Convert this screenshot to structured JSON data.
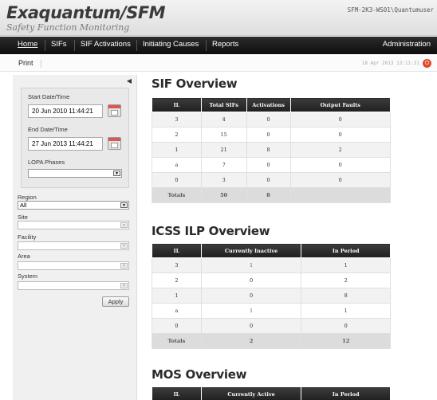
{
  "header": {
    "app_title": "Exaquantum/SFM",
    "app_subtitle": "Safety Function Monitoring",
    "server_user": "SFM-2K3-WS01\\Quantumuser"
  },
  "nav": {
    "items": [
      "Home",
      "SIFs",
      "SIF Activations",
      "Initiating Causes",
      "Reports"
    ],
    "admin": "Administration"
  },
  "toolbar": {
    "print": "Print",
    "timestamp": "18 Apr 2013 13:11:31",
    "status_icon": "power-icon"
  },
  "sidebar": {
    "start_label": "Start Date/Time",
    "start_value": "20 Jun 2010 11:44:21",
    "end_label": "End Date/Time",
    "end_value": "27 Jun 2013 11:44:21",
    "lopa_label": "LOPA Phases",
    "lopa_value": "",
    "region_label": "Region",
    "region_value": "All",
    "site_label": "Site",
    "facility_label": "Facility",
    "area_label": "Area",
    "system_label": "System",
    "apply": "Apply"
  },
  "sif_overview": {
    "title": "SIF Overview",
    "columns": [
      "IL",
      "Total SIFs",
      "Activations",
      "Output Faults"
    ],
    "rows": [
      [
        "3",
        "4",
        "0",
        "0"
      ],
      [
        "2",
        "15",
        "0",
        "0"
      ],
      [
        "1",
        "21",
        "8",
        "2"
      ],
      [
        "a",
        "7",
        "0",
        "0"
      ],
      [
        "0",
        "3",
        "0",
        "0"
      ]
    ],
    "totals": [
      "Totals",
      "50",
      "8",
      ""
    ]
  },
  "icss_overview": {
    "title": "ICSS ILP Overview",
    "columns": [
      "IL",
      "Currently Inactive",
      "In Period"
    ],
    "rows": [
      [
        "3",
        "1",
        "1"
      ],
      [
        "2",
        "0",
        "2"
      ],
      [
        "1",
        "0",
        "8"
      ],
      [
        "a",
        "1",
        "1"
      ],
      [
        "0",
        "0",
        "0"
      ]
    ],
    "totals": [
      "Totals",
      "2",
      "12"
    ]
  },
  "mos_overview": {
    "title": "MOS Overview",
    "columns": [
      "IL",
      "Currently Active",
      "In Period"
    ]
  }
}
